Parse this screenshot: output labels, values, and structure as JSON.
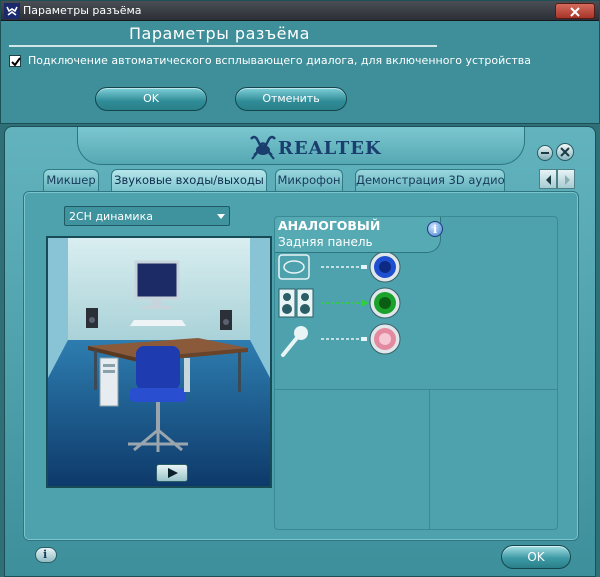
{
  "dialog": {
    "window_title": "Параметры разъёма",
    "heading": "Параметры разъёма",
    "checkbox_label": "Подключение автоматического всплывающего диалога, для включенного устройства",
    "checkbox_checked": true,
    "ok_label": "OK",
    "cancel_label": "Отменить",
    "icon": "realtek-crab-icon",
    "close_icon": "close-icon"
  },
  "main": {
    "logo_text": "REALTEK",
    "tabs": [
      {
        "label": "Микшер",
        "active": false
      },
      {
        "label": "Звуковые входы/выходы",
        "active": true
      },
      {
        "label": "Микрофон",
        "active": false
      },
      {
        "label": "Демонстрация 3D аудио",
        "active": false
      }
    ],
    "speaker_config": "2CH динамика",
    "analog_panel": {
      "title": "АНАЛОГОВЫЙ",
      "subtitle": "Задняя панель",
      "jacks": [
        {
          "device": "line-in-icon",
          "color": "#1f4fd1"
        },
        {
          "device": "speakers-icon",
          "color": "#1aa22a"
        },
        {
          "device": "microphone-icon",
          "color": "#e48aa0"
        }
      ]
    },
    "ok_label": "OK",
    "info_icon": "info-icon",
    "play_icon": "play-icon"
  }
}
